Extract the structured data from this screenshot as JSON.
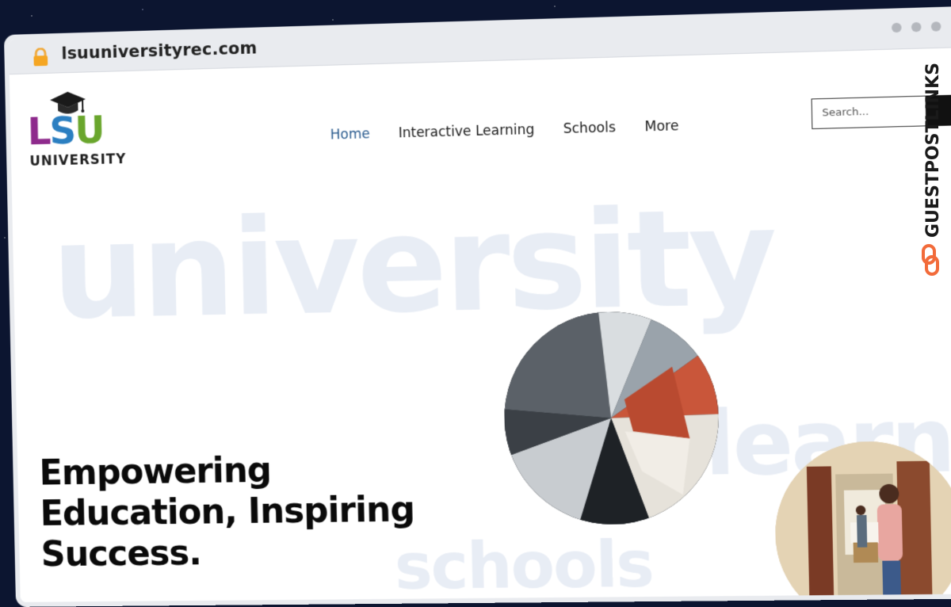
{
  "browser": {
    "url": "lsuuniversityrec.com"
  },
  "logo": {
    "letters": [
      "L",
      "S",
      "U"
    ],
    "subtitle": "UNIVERSITY",
    "colors": {
      "l": "#8e2a8c",
      "s": "#2b7fc1",
      "u": "#6aa62d"
    }
  },
  "nav": {
    "items": [
      {
        "label": "Home",
        "active": true
      },
      {
        "label": "Interactive Learning",
        "active": false
      },
      {
        "label": "Schools",
        "active": false
      },
      {
        "label": "More",
        "active": false
      }
    ]
  },
  "search": {
    "placeholder": "Search..."
  },
  "hero": {
    "bg_words": [
      "university",
      "learnin",
      "schools"
    ],
    "headline_line1": "Empowering",
    "headline_line2": "Education, Inspiring",
    "headline_line3": "Success."
  },
  "watermark": {
    "text": "GUESTPOSTLINKS"
  },
  "colors": {
    "accent": "#2b5c8f",
    "background_word": "#e8edf5",
    "watermark_orange": "#f26b3a"
  }
}
